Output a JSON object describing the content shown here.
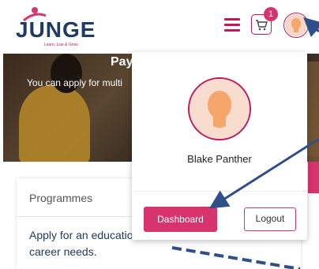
{
  "brand": {
    "name": "JUNGE",
    "tagline": "Learn, Live & Grow",
    "accent": "#d7336c",
    "navy": "#1f3b63"
  },
  "header": {
    "menu_icon": "hamburger-icon",
    "cart_icon": "cart-icon",
    "cart_count": "1",
    "avatar_icon": "user-avatar-icon"
  },
  "hero": {
    "title": "Pay",
    "subtitle": "You can apply for multi"
  },
  "card": {
    "title": "Programmes",
    "text": "Apply for an educatio career needs."
  },
  "dropdown": {
    "user_name": "Blake Panther",
    "dashboard_label": "Dashboard",
    "logout_label": "Logout"
  },
  "annotations": {
    "arrow_color": "#2f4f8a"
  }
}
